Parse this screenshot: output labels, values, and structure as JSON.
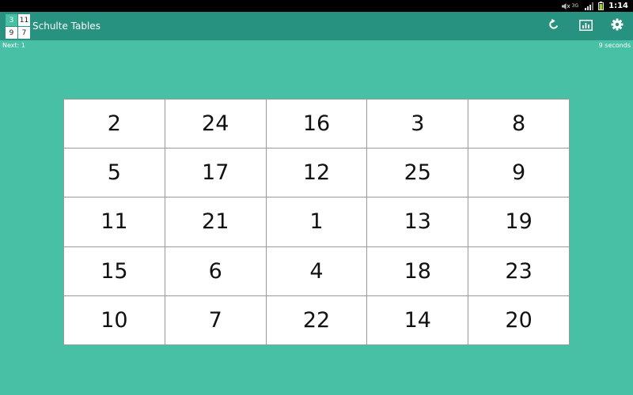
{
  "status_bar": {
    "network_label": "3G",
    "time": "1:14"
  },
  "app": {
    "title": "Schulte Tables",
    "logo_digits": [
      "3",
      "11",
      "9",
      "7"
    ]
  },
  "toolbar": {
    "actions": [
      {
        "name": "restart",
        "icon": "refresh-icon"
      },
      {
        "name": "statistics",
        "icon": "bar-chart-icon"
      },
      {
        "name": "settings",
        "icon": "gear-icon"
      }
    ]
  },
  "game": {
    "next_label": "Next: 1",
    "timer_label": "9 seconds",
    "cells": [
      "2",
      "24",
      "16",
      "3",
      "8",
      "5",
      "17",
      "12",
      "25",
      "9",
      "11",
      "21",
      "1",
      "13",
      "19",
      "15",
      "6",
      "4",
      "18",
      "23",
      "10",
      "7",
      "22",
      "14",
      "20"
    ]
  },
  "colors": {
    "background": "#47c0a5",
    "action_bar": "#27927f",
    "cell_background": "#ffffff",
    "grid_line": "#9a9a9a"
  }
}
